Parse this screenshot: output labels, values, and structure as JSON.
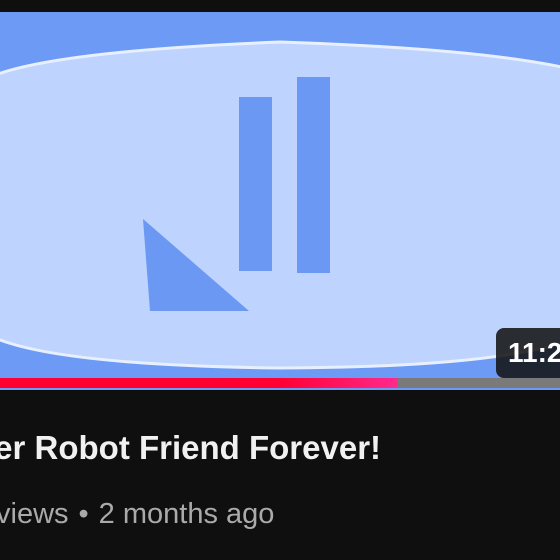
{
  "video": {
    "duration": "11:2",
    "title": "ber Robot Friend Forever!",
    "views": "views",
    "separator": "•",
    "age": "2 months ago",
    "progress": 0.71
  },
  "colors": {
    "thumbnail_bg": "#6c9af4",
    "thumbnail_inner": "#bed3fd",
    "logo_blue": "#6a98f2",
    "progress_red": "#ff0033",
    "progress_pink": "#ff2a8c",
    "progress_track": "#7a7a7a",
    "page_bg": "#0f0f0f",
    "title_text": "#f1f1f1",
    "meta_text": "#aaaaaa"
  },
  "icons": {
    "thumbnail_logo": "triangle-and-bars-icon"
  }
}
